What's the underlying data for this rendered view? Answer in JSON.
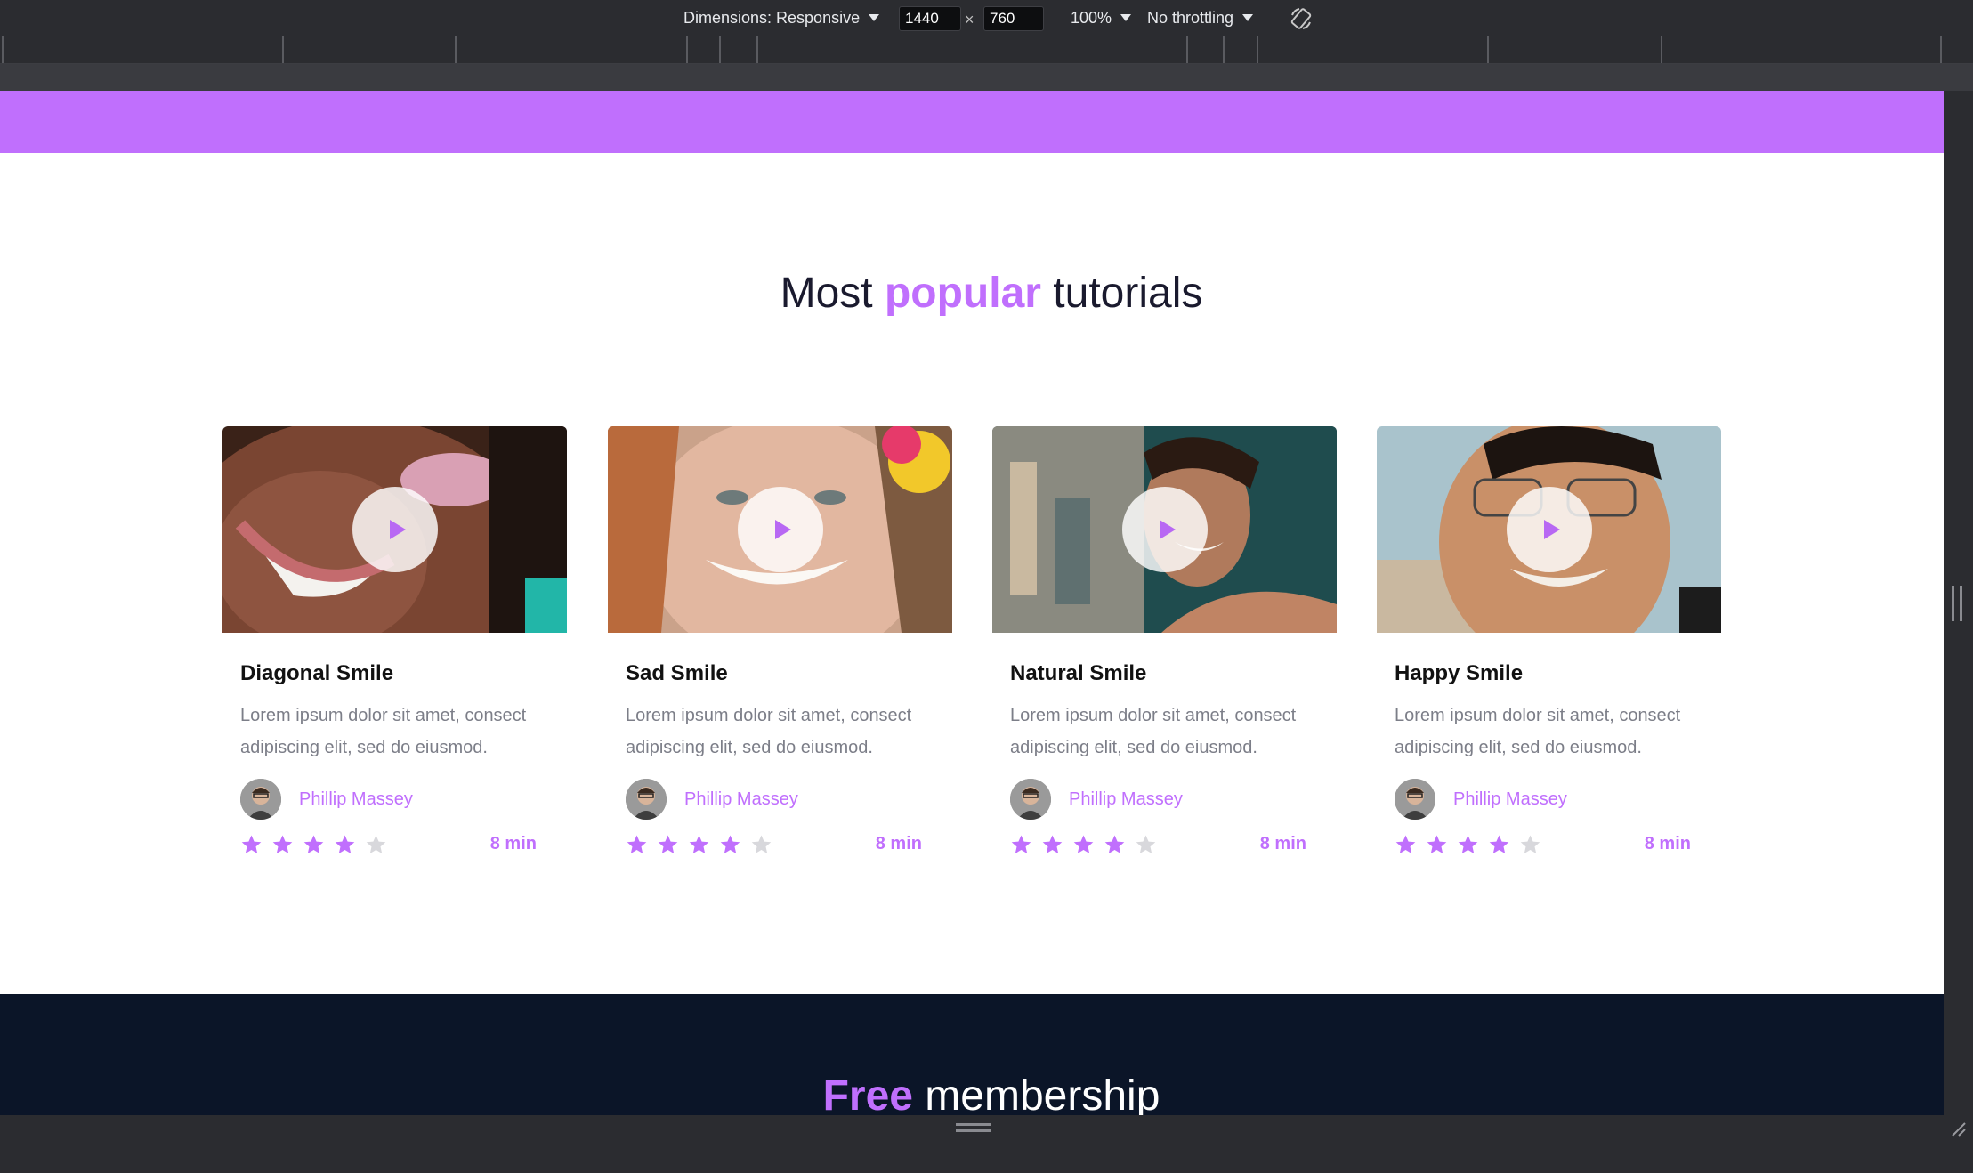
{
  "devtools": {
    "dimensions_label": "Dimensions: Responsive",
    "width_value": "1440",
    "times": "×",
    "height_value": "760",
    "zoom": "100%",
    "throttling": "No throttling",
    "rotate_icon": "rotate-icon"
  },
  "page": {
    "title_pre": "Most ",
    "title_accent": "popular",
    "title_post": " tutorials",
    "accent_color": "#c06ffd",
    "cards": [
      {
        "title": "Diagonal Smile",
        "desc": "Lorem ipsum dolor sit amet, consect adipiscing elit, sed do eiusmod.",
        "author": "Phillip Massey",
        "rating": 4,
        "max_rating": 5,
        "duration": "8 min"
      },
      {
        "title": "Sad Smile",
        "desc": "Lorem ipsum dolor sit amet, consect adipiscing elit, sed do eiusmod.",
        "author": "Phillip Massey",
        "rating": 4,
        "max_rating": 5,
        "duration": "8 min"
      },
      {
        "title": "Natural Smile",
        "desc": "Lorem ipsum dolor sit amet, consect adipiscing elit, sed do eiusmod.",
        "author": "Phillip Massey",
        "rating": 4,
        "max_rating": 5,
        "duration": "8 min"
      },
      {
        "title": "Happy Smile",
        "desc": "Lorem ipsum dolor sit amet, consect adipiscing elit, sed do eiusmod.",
        "author": "Phillip Massey",
        "rating": 4,
        "max_rating": 5,
        "duration": "8 min"
      }
    ],
    "next_section_accent": "Free",
    "next_section_rest": " membership"
  }
}
